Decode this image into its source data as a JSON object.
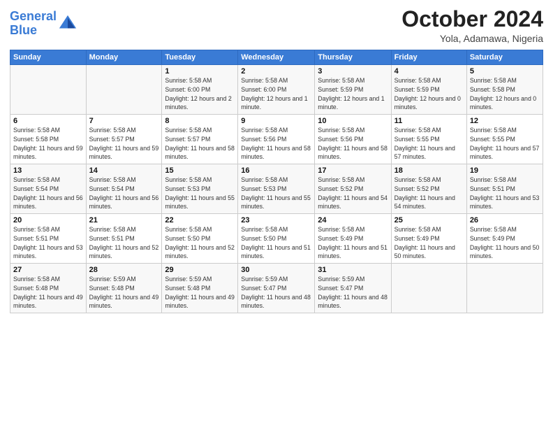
{
  "header": {
    "logo_line1": "General",
    "logo_line2": "Blue",
    "month": "October 2024",
    "location": "Yola, Adamawa, Nigeria"
  },
  "weekdays": [
    "Sunday",
    "Monday",
    "Tuesday",
    "Wednesday",
    "Thursday",
    "Friday",
    "Saturday"
  ],
  "weeks": [
    [
      {
        "day": "",
        "sunrise": "",
        "sunset": "",
        "daylight": ""
      },
      {
        "day": "",
        "sunrise": "",
        "sunset": "",
        "daylight": ""
      },
      {
        "day": "1",
        "sunrise": "Sunrise: 5:58 AM",
        "sunset": "Sunset: 6:00 PM",
        "daylight": "Daylight: 12 hours and 2 minutes."
      },
      {
        "day": "2",
        "sunrise": "Sunrise: 5:58 AM",
        "sunset": "Sunset: 6:00 PM",
        "daylight": "Daylight: 12 hours and 1 minute."
      },
      {
        "day": "3",
        "sunrise": "Sunrise: 5:58 AM",
        "sunset": "Sunset: 5:59 PM",
        "daylight": "Daylight: 12 hours and 1 minute."
      },
      {
        "day": "4",
        "sunrise": "Sunrise: 5:58 AM",
        "sunset": "Sunset: 5:59 PM",
        "daylight": "Daylight: 12 hours and 0 minutes."
      },
      {
        "day": "5",
        "sunrise": "Sunrise: 5:58 AM",
        "sunset": "Sunset: 5:58 PM",
        "daylight": "Daylight: 12 hours and 0 minutes."
      }
    ],
    [
      {
        "day": "6",
        "sunrise": "Sunrise: 5:58 AM",
        "sunset": "Sunset: 5:58 PM",
        "daylight": "Daylight: 11 hours and 59 minutes."
      },
      {
        "day": "7",
        "sunrise": "Sunrise: 5:58 AM",
        "sunset": "Sunset: 5:57 PM",
        "daylight": "Daylight: 11 hours and 59 minutes."
      },
      {
        "day": "8",
        "sunrise": "Sunrise: 5:58 AM",
        "sunset": "Sunset: 5:57 PM",
        "daylight": "Daylight: 11 hours and 58 minutes."
      },
      {
        "day": "9",
        "sunrise": "Sunrise: 5:58 AM",
        "sunset": "Sunset: 5:56 PM",
        "daylight": "Daylight: 11 hours and 58 minutes."
      },
      {
        "day": "10",
        "sunrise": "Sunrise: 5:58 AM",
        "sunset": "Sunset: 5:56 PM",
        "daylight": "Daylight: 11 hours and 58 minutes."
      },
      {
        "day": "11",
        "sunrise": "Sunrise: 5:58 AM",
        "sunset": "Sunset: 5:55 PM",
        "daylight": "Daylight: 11 hours and 57 minutes."
      },
      {
        "day": "12",
        "sunrise": "Sunrise: 5:58 AM",
        "sunset": "Sunset: 5:55 PM",
        "daylight": "Daylight: 11 hours and 57 minutes."
      }
    ],
    [
      {
        "day": "13",
        "sunrise": "Sunrise: 5:58 AM",
        "sunset": "Sunset: 5:54 PM",
        "daylight": "Daylight: 11 hours and 56 minutes."
      },
      {
        "day": "14",
        "sunrise": "Sunrise: 5:58 AM",
        "sunset": "Sunset: 5:54 PM",
        "daylight": "Daylight: 11 hours and 56 minutes."
      },
      {
        "day": "15",
        "sunrise": "Sunrise: 5:58 AM",
        "sunset": "Sunset: 5:53 PM",
        "daylight": "Daylight: 11 hours and 55 minutes."
      },
      {
        "day": "16",
        "sunrise": "Sunrise: 5:58 AM",
        "sunset": "Sunset: 5:53 PM",
        "daylight": "Daylight: 11 hours and 55 minutes."
      },
      {
        "day": "17",
        "sunrise": "Sunrise: 5:58 AM",
        "sunset": "Sunset: 5:52 PM",
        "daylight": "Daylight: 11 hours and 54 minutes."
      },
      {
        "day": "18",
        "sunrise": "Sunrise: 5:58 AM",
        "sunset": "Sunset: 5:52 PM",
        "daylight": "Daylight: 11 hours and 54 minutes."
      },
      {
        "day": "19",
        "sunrise": "Sunrise: 5:58 AM",
        "sunset": "Sunset: 5:51 PM",
        "daylight": "Daylight: 11 hours and 53 minutes."
      }
    ],
    [
      {
        "day": "20",
        "sunrise": "Sunrise: 5:58 AM",
        "sunset": "Sunset: 5:51 PM",
        "daylight": "Daylight: 11 hours and 53 minutes."
      },
      {
        "day": "21",
        "sunrise": "Sunrise: 5:58 AM",
        "sunset": "Sunset: 5:51 PM",
        "daylight": "Daylight: 11 hours and 52 minutes."
      },
      {
        "day": "22",
        "sunrise": "Sunrise: 5:58 AM",
        "sunset": "Sunset: 5:50 PM",
        "daylight": "Daylight: 11 hours and 52 minutes."
      },
      {
        "day": "23",
        "sunrise": "Sunrise: 5:58 AM",
        "sunset": "Sunset: 5:50 PM",
        "daylight": "Daylight: 11 hours and 51 minutes."
      },
      {
        "day": "24",
        "sunrise": "Sunrise: 5:58 AM",
        "sunset": "Sunset: 5:49 PM",
        "daylight": "Daylight: 11 hours and 51 minutes."
      },
      {
        "day": "25",
        "sunrise": "Sunrise: 5:58 AM",
        "sunset": "Sunset: 5:49 PM",
        "daylight": "Daylight: 11 hours and 50 minutes."
      },
      {
        "day": "26",
        "sunrise": "Sunrise: 5:58 AM",
        "sunset": "Sunset: 5:49 PM",
        "daylight": "Daylight: 11 hours and 50 minutes."
      }
    ],
    [
      {
        "day": "27",
        "sunrise": "Sunrise: 5:58 AM",
        "sunset": "Sunset: 5:48 PM",
        "daylight": "Daylight: 11 hours and 49 minutes."
      },
      {
        "day": "28",
        "sunrise": "Sunrise: 5:59 AM",
        "sunset": "Sunset: 5:48 PM",
        "daylight": "Daylight: 11 hours and 49 minutes."
      },
      {
        "day": "29",
        "sunrise": "Sunrise: 5:59 AM",
        "sunset": "Sunset: 5:48 PM",
        "daylight": "Daylight: 11 hours and 49 minutes."
      },
      {
        "day": "30",
        "sunrise": "Sunrise: 5:59 AM",
        "sunset": "Sunset: 5:47 PM",
        "daylight": "Daylight: 11 hours and 48 minutes."
      },
      {
        "day": "31",
        "sunrise": "Sunrise: 5:59 AM",
        "sunset": "Sunset: 5:47 PM",
        "daylight": "Daylight: 11 hours and 48 minutes."
      },
      {
        "day": "",
        "sunrise": "",
        "sunset": "",
        "daylight": ""
      },
      {
        "day": "",
        "sunrise": "",
        "sunset": "",
        "daylight": ""
      }
    ]
  ]
}
